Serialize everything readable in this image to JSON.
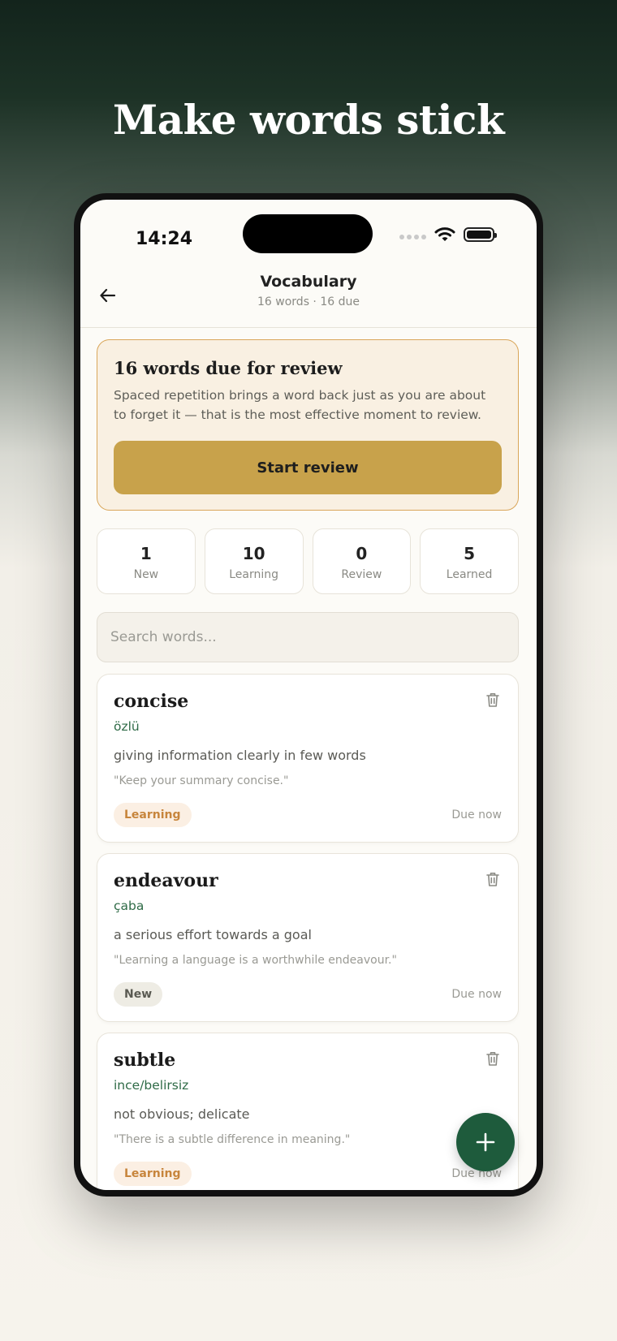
{
  "hero": {
    "title": "Make words stick"
  },
  "status_bar": {
    "time": "14:24"
  },
  "header": {
    "title": "Vocabulary",
    "subtitle": "16 words · 16 due"
  },
  "review": {
    "title": "16 words due for review",
    "description": "Spaced repetition brings a word back just as you are about to forget it — that is the most effective moment to review.",
    "button_label": "Start review"
  },
  "stats": [
    {
      "value": "1",
      "label": "New"
    },
    {
      "value": "10",
      "label": "Learning"
    },
    {
      "value": "0",
      "label": "Review"
    },
    {
      "value": "5",
      "label": "Learned"
    }
  ],
  "search": {
    "placeholder": "Search words..."
  },
  "words": [
    {
      "word": "concise",
      "translation": "özlü",
      "definition": "giving information clearly in few words",
      "example": "\"Keep your summary concise.\"",
      "status": "Learning",
      "due": "Due now"
    },
    {
      "word": "endeavour",
      "translation": "çaba",
      "definition": "a serious effort towards a goal",
      "example": "\"Learning a language is a worthwhile endeavour.\"",
      "status": "New",
      "due": "Due now"
    },
    {
      "word": "subtle",
      "translation": "ince/belirsiz",
      "definition": "not obvious; delicate",
      "example": "\"There is a subtle difference in meaning.\"",
      "status": "Learning",
      "due": "Due now"
    }
  ],
  "icons": {
    "back": "arrow-left-icon",
    "delete": "trash-icon",
    "add": "plus-icon",
    "wifi": "wifi-icon",
    "battery": "battery-icon"
  },
  "colors": {
    "accent_green": "#1e5b3c",
    "review_gold": "#c8a24b",
    "learning_orange": "#c7853c"
  }
}
